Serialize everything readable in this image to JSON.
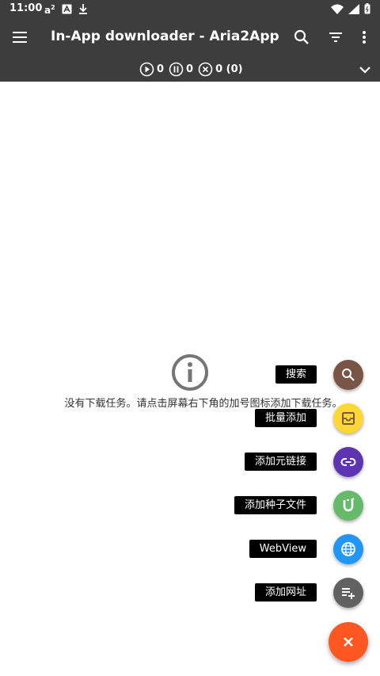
{
  "status_bar": {
    "time": "11:00",
    "icons": [
      "a2-icon",
      "a-icon",
      "download-icon"
    ],
    "right_icons": [
      "wifi-icon",
      "signal-icon",
      "battery-icon"
    ]
  },
  "app_bar": {
    "title": "In-App downloader - Aria2App",
    "actions": [
      "search-icon",
      "filter-icon",
      "more-icon"
    ]
  },
  "stats": {
    "active": "0",
    "paused": "0",
    "stopped": "0 (0)"
  },
  "empty_state": {
    "message": "没有下载任务。请点击屏幕右下角的加号图标添加下载任务。"
  },
  "fab_menu": {
    "items": [
      {
        "label": "搜索",
        "icon": "search-icon",
        "color": "#795548"
      },
      {
        "label": "批量添加",
        "icon": "batch-icon",
        "color": "#fdd835"
      },
      {
        "label": "添加元链接",
        "icon": "link-icon",
        "color": "#5e35b1"
      },
      {
        "label": "添加种子文件",
        "icon": "torrent-icon",
        "color": "#66bb6a"
      },
      {
        "label": "WebView",
        "icon": "globe-icon",
        "color": "#2196f3"
      },
      {
        "label": "添加网址",
        "icon": "playlist-add-icon",
        "color": "#616161"
      }
    ],
    "main_color": "#ff5722",
    "main_icon": "close-icon"
  },
  "colors": {
    "bar_background": "#3d3d3d",
    "text_on_bar": "#ffffff"
  }
}
